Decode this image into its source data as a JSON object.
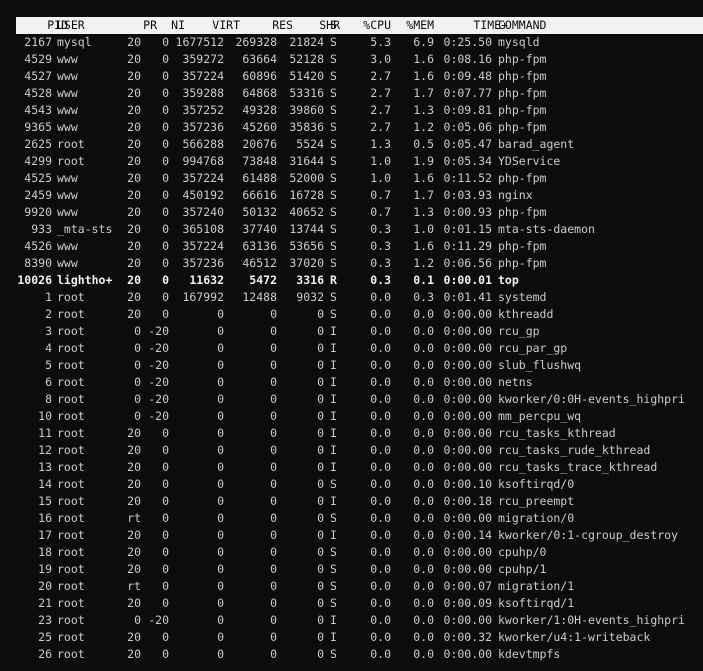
{
  "headers": {
    "pid": "PID",
    "user": "USER",
    "pr": "PR",
    "ni": "NI",
    "virt": "VIRT",
    "res": "RES",
    "shr": "SHR",
    "s": "S",
    "cpu": "%CPU",
    "mem": "%MEM",
    "time": "TIME+",
    "command": "COMMAND"
  },
  "processes": [
    {
      "pid": "2167",
      "user": "mysql",
      "pr": "20",
      "ni": "0",
      "virt": "1677512",
      "res": "269328",
      "shr": "21824",
      "s": "S",
      "cpu": "5.3",
      "mem": "6.9",
      "time": "0:25.50",
      "command": "mysqld"
    },
    {
      "pid": "4529",
      "user": "www",
      "pr": "20",
      "ni": "0",
      "virt": "359272",
      "res": "63664",
      "shr": "52128",
      "s": "S",
      "cpu": "3.0",
      "mem": "1.6",
      "time": "0:08.16",
      "command": "php-fpm"
    },
    {
      "pid": "4527",
      "user": "www",
      "pr": "20",
      "ni": "0",
      "virt": "357224",
      "res": "60896",
      "shr": "51420",
      "s": "S",
      "cpu": "2.7",
      "mem": "1.6",
      "time": "0:09.48",
      "command": "php-fpm"
    },
    {
      "pid": "4528",
      "user": "www",
      "pr": "20",
      "ni": "0",
      "virt": "359288",
      "res": "64868",
      "shr": "53316",
      "s": "S",
      "cpu": "2.7",
      "mem": "1.7",
      "time": "0:07.77",
      "command": "php-fpm"
    },
    {
      "pid": "4543",
      "user": "www",
      "pr": "20",
      "ni": "0",
      "virt": "357252",
      "res": "49328",
      "shr": "39860",
      "s": "S",
      "cpu": "2.7",
      "mem": "1.3",
      "time": "0:09.81",
      "command": "php-fpm"
    },
    {
      "pid": "9365",
      "user": "www",
      "pr": "20",
      "ni": "0",
      "virt": "357236",
      "res": "45260",
      "shr": "35836",
      "s": "S",
      "cpu": "2.7",
      "mem": "1.2",
      "time": "0:05.06",
      "command": "php-fpm"
    },
    {
      "pid": "2625",
      "user": "root",
      "pr": "20",
      "ni": "0",
      "virt": "566288",
      "res": "20676",
      "shr": "5524",
      "s": "S",
      "cpu": "1.3",
      "mem": "0.5",
      "time": "0:05.47",
      "command": "barad_agent"
    },
    {
      "pid": "4299",
      "user": "root",
      "pr": "20",
      "ni": "0",
      "virt": "994768",
      "res": "73848",
      "shr": "31644",
      "s": "S",
      "cpu": "1.0",
      "mem": "1.9",
      "time": "0:05.34",
      "command": "YDService"
    },
    {
      "pid": "4525",
      "user": "www",
      "pr": "20",
      "ni": "0",
      "virt": "357224",
      "res": "61488",
      "shr": "52000",
      "s": "S",
      "cpu": "1.0",
      "mem": "1.6",
      "time": "0:11.52",
      "command": "php-fpm"
    },
    {
      "pid": "2459",
      "user": "www",
      "pr": "20",
      "ni": "0",
      "virt": "450192",
      "res": "66616",
      "shr": "16728",
      "s": "S",
      "cpu": "0.7",
      "mem": "1.7",
      "time": "0:03.93",
      "command": "nginx"
    },
    {
      "pid": "9920",
      "user": "www",
      "pr": "20",
      "ni": "0",
      "virt": "357240",
      "res": "50132",
      "shr": "40652",
      "s": "S",
      "cpu": "0.7",
      "mem": "1.3",
      "time": "0:00.93",
      "command": "php-fpm"
    },
    {
      "pid": "933",
      "user": "_mta-sts",
      "pr": "20",
      "ni": "0",
      "virt": "365108",
      "res": "37740",
      "shr": "13744",
      "s": "S",
      "cpu": "0.3",
      "mem": "1.0",
      "time": "0:01.15",
      "command": "mta-sts-daemon"
    },
    {
      "pid": "4526",
      "user": "www",
      "pr": "20",
      "ni": "0",
      "virt": "357224",
      "res": "63136",
      "shr": "53656",
      "s": "S",
      "cpu": "0.3",
      "mem": "1.6",
      "time": "0:11.29",
      "command": "php-fpm"
    },
    {
      "pid": "8390",
      "user": "www",
      "pr": "20",
      "ni": "0",
      "virt": "357236",
      "res": "46512",
      "shr": "37020",
      "s": "S",
      "cpu": "0.3",
      "mem": "1.2",
      "time": "0:06.56",
      "command": "php-fpm"
    },
    {
      "pid": "10026",
      "user": "lightho+",
      "pr": "20",
      "ni": "0",
      "virt": "11632",
      "res": "5472",
      "shr": "3316",
      "s": "R",
      "cpu": "0.3",
      "mem": "0.1",
      "time": "0:00.01",
      "command": "top",
      "bold": true
    },
    {
      "pid": "1",
      "user": "root",
      "pr": "20",
      "ni": "0",
      "virt": "167992",
      "res": "12488",
      "shr": "9032",
      "s": "S",
      "cpu": "0.0",
      "mem": "0.3",
      "time": "0:01.41",
      "command": "systemd"
    },
    {
      "pid": "2",
      "user": "root",
      "pr": "20",
      "ni": "0",
      "virt": "0",
      "res": "0",
      "shr": "0",
      "s": "S",
      "cpu": "0.0",
      "mem": "0.0",
      "time": "0:00.00",
      "command": "kthreadd"
    },
    {
      "pid": "3",
      "user": "root",
      "pr": "0",
      "ni": "-20",
      "virt": "0",
      "res": "0",
      "shr": "0",
      "s": "I",
      "cpu": "0.0",
      "mem": "0.0",
      "time": "0:00.00",
      "command": "rcu_gp"
    },
    {
      "pid": "4",
      "user": "root",
      "pr": "0",
      "ni": "-20",
      "virt": "0",
      "res": "0",
      "shr": "0",
      "s": "I",
      "cpu": "0.0",
      "mem": "0.0",
      "time": "0:00.00",
      "command": "rcu_par_gp"
    },
    {
      "pid": "5",
      "user": "root",
      "pr": "0",
      "ni": "-20",
      "virt": "0",
      "res": "0",
      "shr": "0",
      "s": "I",
      "cpu": "0.0",
      "mem": "0.0",
      "time": "0:00.00",
      "command": "slub_flushwq"
    },
    {
      "pid": "6",
      "user": "root",
      "pr": "0",
      "ni": "-20",
      "virt": "0",
      "res": "0",
      "shr": "0",
      "s": "I",
      "cpu": "0.0",
      "mem": "0.0",
      "time": "0:00.00",
      "command": "netns"
    },
    {
      "pid": "8",
      "user": "root",
      "pr": "0",
      "ni": "-20",
      "virt": "0",
      "res": "0",
      "shr": "0",
      "s": "I",
      "cpu": "0.0",
      "mem": "0.0",
      "time": "0:00.00",
      "command": "kworker/0:0H-events_highpri"
    },
    {
      "pid": "10",
      "user": "root",
      "pr": "0",
      "ni": "-20",
      "virt": "0",
      "res": "0",
      "shr": "0",
      "s": "I",
      "cpu": "0.0",
      "mem": "0.0",
      "time": "0:00.00",
      "command": "mm_percpu_wq"
    },
    {
      "pid": "11",
      "user": "root",
      "pr": "20",
      "ni": "0",
      "virt": "0",
      "res": "0",
      "shr": "0",
      "s": "I",
      "cpu": "0.0",
      "mem": "0.0",
      "time": "0:00.00",
      "command": "rcu_tasks_kthread"
    },
    {
      "pid": "12",
      "user": "root",
      "pr": "20",
      "ni": "0",
      "virt": "0",
      "res": "0",
      "shr": "0",
      "s": "I",
      "cpu": "0.0",
      "mem": "0.0",
      "time": "0:00.00",
      "command": "rcu_tasks_rude_kthread"
    },
    {
      "pid": "13",
      "user": "root",
      "pr": "20",
      "ni": "0",
      "virt": "0",
      "res": "0",
      "shr": "0",
      "s": "I",
      "cpu": "0.0",
      "mem": "0.0",
      "time": "0:00.00",
      "command": "rcu_tasks_trace_kthread"
    },
    {
      "pid": "14",
      "user": "root",
      "pr": "20",
      "ni": "0",
      "virt": "0",
      "res": "0",
      "shr": "0",
      "s": "S",
      "cpu": "0.0",
      "mem": "0.0",
      "time": "0:00.10",
      "command": "ksoftirqd/0"
    },
    {
      "pid": "15",
      "user": "root",
      "pr": "20",
      "ni": "0",
      "virt": "0",
      "res": "0",
      "shr": "0",
      "s": "I",
      "cpu": "0.0",
      "mem": "0.0",
      "time": "0:00.18",
      "command": "rcu_preempt"
    },
    {
      "pid": "16",
      "user": "root",
      "pr": "rt",
      "ni": "0",
      "virt": "0",
      "res": "0",
      "shr": "0",
      "s": "S",
      "cpu": "0.0",
      "mem": "0.0",
      "time": "0:00.00",
      "command": "migration/0"
    },
    {
      "pid": "17",
      "user": "root",
      "pr": "20",
      "ni": "0",
      "virt": "0",
      "res": "0",
      "shr": "0",
      "s": "I",
      "cpu": "0.0",
      "mem": "0.0",
      "time": "0:00.14",
      "command": "kworker/0:1-cgroup_destroy"
    },
    {
      "pid": "18",
      "user": "root",
      "pr": "20",
      "ni": "0",
      "virt": "0",
      "res": "0",
      "shr": "0",
      "s": "S",
      "cpu": "0.0",
      "mem": "0.0",
      "time": "0:00.00",
      "command": "cpuhp/0"
    },
    {
      "pid": "19",
      "user": "root",
      "pr": "20",
      "ni": "0",
      "virt": "0",
      "res": "0",
      "shr": "0",
      "s": "S",
      "cpu": "0.0",
      "mem": "0.0",
      "time": "0:00.00",
      "command": "cpuhp/1"
    },
    {
      "pid": "20",
      "user": "root",
      "pr": "rt",
      "ni": "0",
      "virt": "0",
      "res": "0",
      "shr": "0",
      "s": "S",
      "cpu": "0.0",
      "mem": "0.0",
      "time": "0:00.07",
      "command": "migration/1"
    },
    {
      "pid": "21",
      "user": "root",
      "pr": "20",
      "ni": "0",
      "virt": "0",
      "res": "0",
      "shr": "0",
      "s": "S",
      "cpu": "0.0",
      "mem": "0.0",
      "time": "0:00.09",
      "command": "ksoftirqd/1"
    },
    {
      "pid": "23",
      "user": "root",
      "pr": "0",
      "ni": "-20",
      "virt": "0",
      "res": "0",
      "shr": "0",
      "s": "I",
      "cpu": "0.0",
      "mem": "0.0",
      "time": "0:00.00",
      "command": "kworker/1:0H-events_highpri"
    },
    {
      "pid": "25",
      "user": "root",
      "pr": "20",
      "ni": "0",
      "virt": "0",
      "res": "0",
      "shr": "0",
      "s": "I",
      "cpu": "0.0",
      "mem": "0.0",
      "time": "0:00.32",
      "command": "kworker/u4:1-writeback"
    },
    {
      "pid": "26",
      "user": "root",
      "pr": "20",
      "ni": "0",
      "virt": "0",
      "res": "0",
      "shr": "0",
      "s": "S",
      "cpu": "0.0",
      "mem": "0.0",
      "time": "0:00.00",
      "command": "kdevtmpfs"
    }
  ]
}
